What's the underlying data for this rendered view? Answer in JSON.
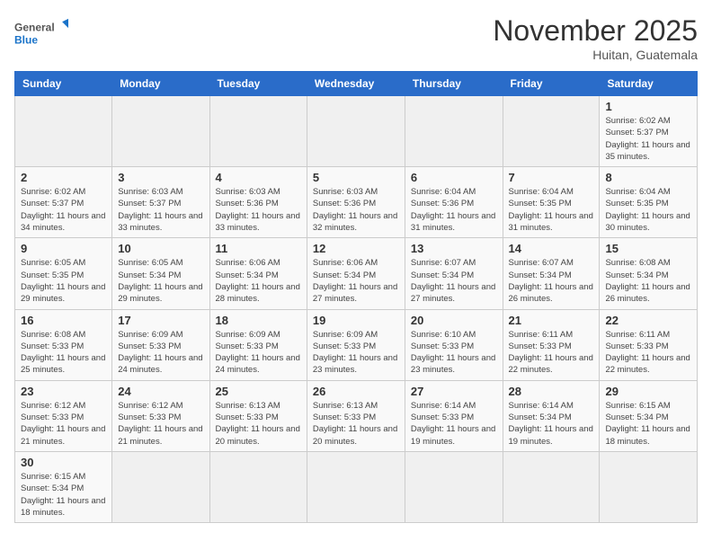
{
  "header": {
    "logo_general": "General",
    "logo_blue": "Blue",
    "month_title": "November 2025",
    "location": "Huitan, Guatemala"
  },
  "days_of_week": [
    "Sunday",
    "Monday",
    "Tuesday",
    "Wednesday",
    "Thursday",
    "Friday",
    "Saturday"
  ],
  "weeks": [
    [
      {
        "day": "",
        "info": ""
      },
      {
        "day": "",
        "info": ""
      },
      {
        "day": "",
        "info": ""
      },
      {
        "day": "",
        "info": ""
      },
      {
        "day": "",
        "info": ""
      },
      {
        "day": "",
        "info": ""
      },
      {
        "day": "1",
        "info": "Sunrise: 6:02 AM\nSunset: 5:37 PM\nDaylight: 11 hours and 35 minutes."
      }
    ],
    [
      {
        "day": "2",
        "info": "Sunrise: 6:02 AM\nSunset: 5:37 PM\nDaylight: 11 hours and 34 minutes."
      },
      {
        "day": "3",
        "info": "Sunrise: 6:03 AM\nSunset: 5:37 PM\nDaylight: 11 hours and 33 minutes."
      },
      {
        "day": "4",
        "info": "Sunrise: 6:03 AM\nSunset: 5:36 PM\nDaylight: 11 hours and 33 minutes."
      },
      {
        "day": "5",
        "info": "Sunrise: 6:03 AM\nSunset: 5:36 PM\nDaylight: 11 hours and 32 minutes."
      },
      {
        "day": "6",
        "info": "Sunrise: 6:04 AM\nSunset: 5:36 PM\nDaylight: 11 hours and 31 minutes."
      },
      {
        "day": "7",
        "info": "Sunrise: 6:04 AM\nSunset: 5:35 PM\nDaylight: 11 hours and 31 minutes."
      },
      {
        "day": "8",
        "info": "Sunrise: 6:04 AM\nSunset: 5:35 PM\nDaylight: 11 hours and 30 minutes."
      }
    ],
    [
      {
        "day": "9",
        "info": "Sunrise: 6:05 AM\nSunset: 5:35 PM\nDaylight: 11 hours and 29 minutes."
      },
      {
        "day": "10",
        "info": "Sunrise: 6:05 AM\nSunset: 5:34 PM\nDaylight: 11 hours and 29 minutes."
      },
      {
        "day": "11",
        "info": "Sunrise: 6:06 AM\nSunset: 5:34 PM\nDaylight: 11 hours and 28 minutes."
      },
      {
        "day": "12",
        "info": "Sunrise: 6:06 AM\nSunset: 5:34 PM\nDaylight: 11 hours and 27 minutes."
      },
      {
        "day": "13",
        "info": "Sunrise: 6:07 AM\nSunset: 5:34 PM\nDaylight: 11 hours and 27 minutes."
      },
      {
        "day": "14",
        "info": "Sunrise: 6:07 AM\nSunset: 5:34 PM\nDaylight: 11 hours and 26 minutes."
      },
      {
        "day": "15",
        "info": "Sunrise: 6:08 AM\nSunset: 5:34 PM\nDaylight: 11 hours and 26 minutes."
      }
    ],
    [
      {
        "day": "16",
        "info": "Sunrise: 6:08 AM\nSunset: 5:33 PM\nDaylight: 11 hours and 25 minutes."
      },
      {
        "day": "17",
        "info": "Sunrise: 6:09 AM\nSunset: 5:33 PM\nDaylight: 11 hours and 24 minutes."
      },
      {
        "day": "18",
        "info": "Sunrise: 6:09 AM\nSunset: 5:33 PM\nDaylight: 11 hours and 24 minutes."
      },
      {
        "day": "19",
        "info": "Sunrise: 6:09 AM\nSunset: 5:33 PM\nDaylight: 11 hours and 23 minutes."
      },
      {
        "day": "20",
        "info": "Sunrise: 6:10 AM\nSunset: 5:33 PM\nDaylight: 11 hours and 23 minutes."
      },
      {
        "day": "21",
        "info": "Sunrise: 6:11 AM\nSunset: 5:33 PM\nDaylight: 11 hours and 22 minutes."
      },
      {
        "day": "22",
        "info": "Sunrise: 6:11 AM\nSunset: 5:33 PM\nDaylight: 11 hours and 22 minutes."
      }
    ],
    [
      {
        "day": "23",
        "info": "Sunrise: 6:12 AM\nSunset: 5:33 PM\nDaylight: 11 hours and 21 minutes."
      },
      {
        "day": "24",
        "info": "Sunrise: 6:12 AM\nSunset: 5:33 PM\nDaylight: 11 hours and 21 minutes."
      },
      {
        "day": "25",
        "info": "Sunrise: 6:13 AM\nSunset: 5:33 PM\nDaylight: 11 hours and 20 minutes."
      },
      {
        "day": "26",
        "info": "Sunrise: 6:13 AM\nSunset: 5:33 PM\nDaylight: 11 hours and 20 minutes."
      },
      {
        "day": "27",
        "info": "Sunrise: 6:14 AM\nSunset: 5:33 PM\nDaylight: 11 hours and 19 minutes."
      },
      {
        "day": "28",
        "info": "Sunrise: 6:14 AM\nSunset: 5:34 PM\nDaylight: 11 hours and 19 minutes."
      },
      {
        "day": "29",
        "info": "Sunrise: 6:15 AM\nSunset: 5:34 PM\nDaylight: 11 hours and 18 minutes."
      }
    ],
    [
      {
        "day": "30",
        "info": "Sunrise: 6:15 AM\nSunset: 5:34 PM\nDaylight: 11 hours and 18 minutes."
      },
      {
        "day": "",
        "info": ""
      },
      {
        "day": "",
        "info": ""
      },
      {
        "day": "",
        "info": ""
      },
      {
        "day": "",
        "info": ""
      },
      {
        "day": "",
        "info": ""
      },
      {
        "day": "",
        "info": ""
      }
    ]
  ]
}
